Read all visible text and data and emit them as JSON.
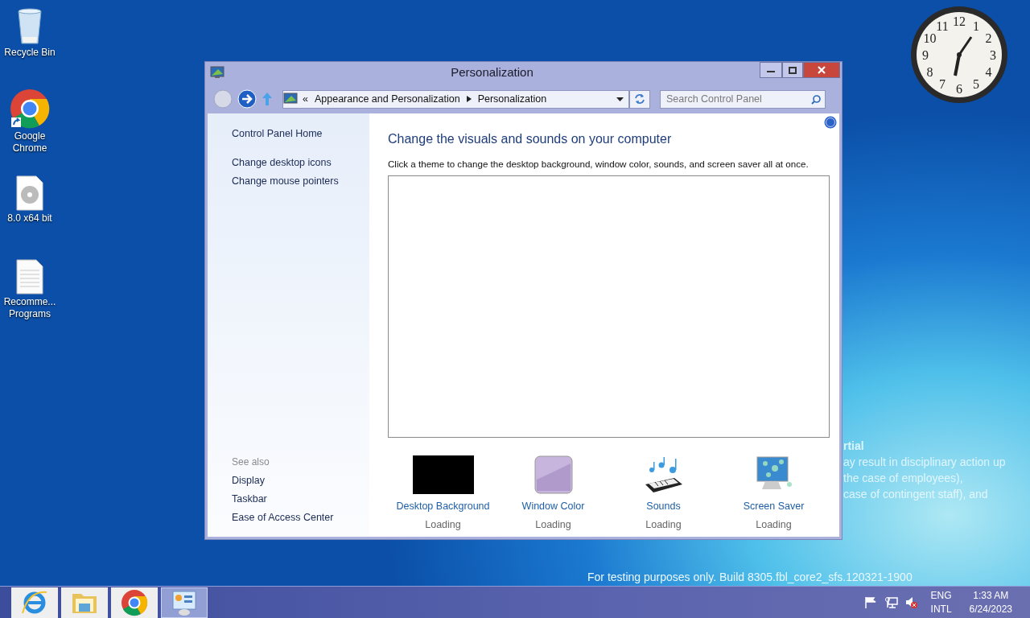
{
  "desktop_icons": [
    {
      "label": "Recycle Bin",
      "kind": "recycle"
    },
    {
      "label": "Google Chrome",
      "kind": "chrome"
    },
    {
      "label": "8.0 x64 bit",
      "kind": "disc"
    },
    {
      "label": "Recomme... Programs",
      "kind": "document"
    }
  ],
  "clock": {
    "numeral_rows": [
      [
        "12"
      ],
      [
        "11",
        "1"
      ],
      [
        "10",
        "2"
      ],
      [
        "9",
        "3"
      ],
      [
        "8",
        "4"
      ],
      [
        "7",
        "5"
      ],
      [
        "6"
      ]
    ]
  },
  "wallpaper_text": [
    "rtial",
    "ay result in disciplinary action up",
    "the case of employees),",
    "case of contingent staff), and"
  ],
  "build_text": "For testing purposes only. Build 8305.fbl_core2_sfs.120321-1900",
  "window": {
    "title": "Personalization",
    "address": {
      "overflow": "«",
      "breadcrumb": [
        "Appearance and Personalization",
        "Personalization"
      ]
    },
    "search": {
      "placeholder": "Search Control Panel"
    },
    "sidebar": {
      "links": [
        "Control Panel Home",
        "Change desktop icons",
        "Change mouse pointers"
      ],
      "see_also": {
        "heading": "See also",
        "links": [
          "Display",
          "Taskbar",
          "Ease of Access Center"
        ]
      }
    },
    "heading": "Change the visuals and sounds on your computer",
    "description": "Click a theme to change the desktop background, window color, sounds, and screen saver all at once.",
    "tiles": [
      {
        "label": "Desktop Background",
        "status": "Loading",
        "kind": "background"
      },
      {
        "label": "Window Color",
        "status": "Loading",
        "kind": "color"
      },
      {
        "label": "Sounds",
        "status": "Loading",
        "kind": "sounds"
      },
      {
        "label": "Screen Saver",
        "status": "Loading",
        "kind": "screensaver"
      }
    ]
  },
  "taskbar": {
    "apps": [
      {
        "kind": "ie",
        "selected": false
      },
      {
        "kind": "explorer",
        "selected": false
      },
      {
        "kind": "chrome",
        "selected": false
      },
      {
        "kind": "control",
        "selected": true
      }
    ],
    "tray": [
      {
        "kind": "flag"
      },
      {
        "kind": "network"
      },
      {
        "kind": "volume-muted"
      }
    ],
    "language": [
      "ENG",
      "INTL"
    ],
    "time": "1:33 AM",
    "date": "6/24/2023"
  }
}
